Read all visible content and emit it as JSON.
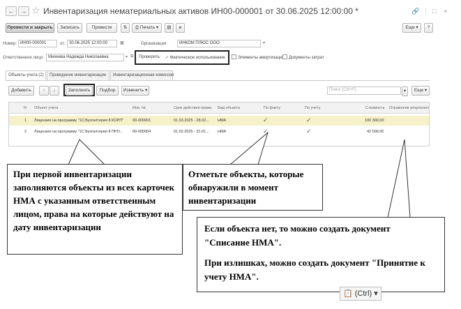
{
  "window": {
    "title": "Инвентаризация нематериальных активов ИН00-000001 от 30.06.2025 12:00:00 *",
    "back": "←",
    "forward": "→",
    "star": "☆",
    "icons": [
      "🔗",
      "⋮",
      "□",
      "×"
    ]
  },
  "toolbar": {
    "post_close": "Провести и закрыть",
    "save": "Записать",
    "post": "Провести",
    "print": "Печать",
    "more": "Еще",
    "help": "?"
  },
  "header": {
    "number_label": "Номер:",
    "number_value": "ИН00-000001",
    "from_label": "от:",
    "date_value": "30.06.2025 12:00:00",
    "org_label": "Организация:",
    "org_value": "ИНКОМ ПЛЮС ООО",
    "resp_label": "Ответственное лицо:",
    "resp_value": "Михеева Надежда Николаевна",
    "check_label": "Проверять:",
    "check_actual": "Фактическое использование",
    "check_amort": "Элементы амортизации",
    "check_docs": "Документы затрат"
  },
  "tabs": [
    {
      "label": "Объекты учета (2)"
    },
    {
      "label": "Проведение инвентаризации"
    },
    {
      "label": "Инвентаризационная комиссия"
    }
  ],
  "table_toolbar": {
    "add": "Добавить",
    "up": "↑",
    "down": "↓",
    "fill": "Заполнить",
    "pick": "Подбор",
    "change": "Изменить",
    "search_placeholder": "Поиск (Ctrl+F)",
    "more": "Еще"
  },
  "columns": [
    "N",
    "Объект учета",
    "Инв. №",
    "Срок действия права",
    "Вид объекта",
    "По факту",
    "По учету",
    "Стоимость",
    "Отражение результата"
  ],
  "rows": [
    {
      "n": "1",
      "object": "Лицензия на программу \"1С:Бухгалтерия 8 КОРП\"",
      "inv": "00-000001",
      "period": "01.03.2025 - 28.02...",
      "kind": "НМА",
      "fact": "✓",
      "book": "✓",
      "cost": "100 300,00"
    },
    {
      "n": "2",
      "object": "Лицензия на программу \"1С:Бухгалтерия 8 ПРО...",
      "inv": "00-000004",
      "period": "01.02.2025 - 31.01...",
      "kind": "НМА",
      "fact": "✓",
      "book": "✓",
      "cost": "42 000,00"
    }
  ],
  "callouts": {
    "left": "При первой инвентаризации заполняются объекты из всех карточек НМА с указанным ответственным лицом, права на которые действуют на дату инвентаризации",
    "middle": "Отметьте объекты, которые обнаружили в момент инвентаризации",
    "right_1": "Если объекта нет, то можно создать документ \"Списание НМА\".",
    "right_2": "При излишках, можно создать документ \"Принятие к учету НМА\"."
  },
  "paste_popup": {
    "label": "(Ctrl)",
    "icon": "clipboard-icon"
  }
}
